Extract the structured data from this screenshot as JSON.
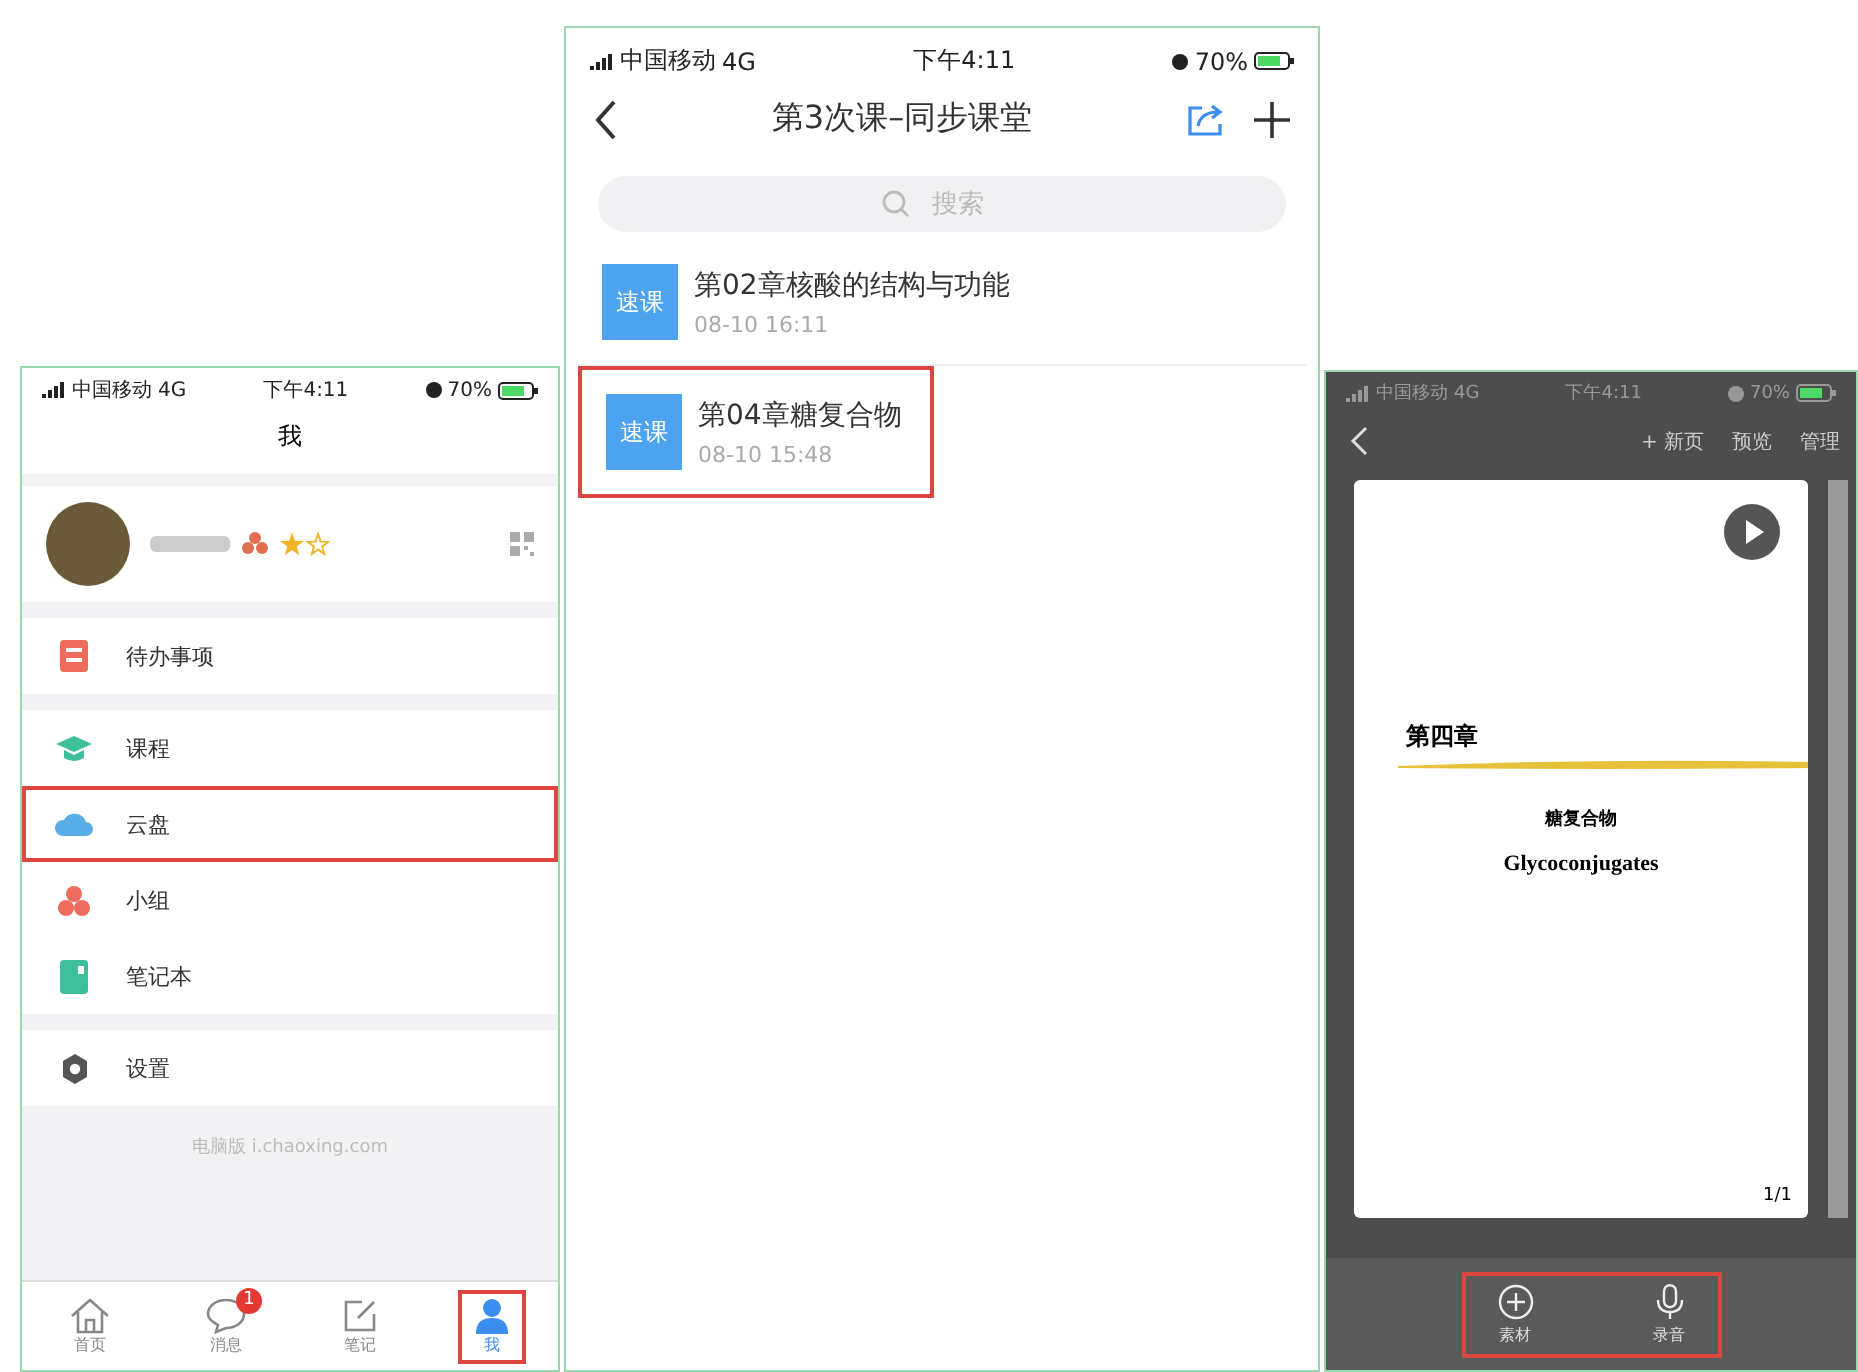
{
  "profile_screen": {
    "status_bar": {
      "carrier": "中国移动",
      "network": "4G",
      "time": "下午4:11",
      "battery": "70%"
    },
    "title": "我",
    "menu_groups": [
      [
        {
          "label": "待办事项",
          "kind": "todo",
          "highlighted": false
        }
      ],
      [
        {
          "label": "课程",
          "kind": "course",
          "highlighted": false
        },
        {
          "label": "云盘",
          "kind": "cloud",
          "highlighted": true
        },
        {
          "label": "小组",
          "kind": "group",
          "highlighted": false
        },
        {
          "label": "笔记本",
          "kind": "notebook",
          "highlighted": false
        }
      ],
      [
        {
          "label": "设置",
          "kind": "settings",
          "highlighted": false
        }
      ]
    ],
    "footer": "电脑版 i.chaoxing.com",
    "tabs": [
      {
        "label": "首页",
        "kind": "home",
        "selected": false,
        "highlighted": false
      },
      {
        "label": "消息",
        "kind": "chat",
        "selected": false,
        "highlighted": false,
        "badge": "1"
      },
      {
        "label": "笔记",
        "kind": "note",
        "selected": false,
        "highlighted": false
      },
      {
        "label": "我",
        "kind": "person",
        "selected": true,
        "highlighted": true
      }
    ]
  },
  "lesson_list_screen": {
    "status_bar": {
      "carrier": "中国移动",
      "network": "4G",
      "time": "下午4:11",
      "battery": "70%"
    },
    "title": "第3次课–同步课堂",
    "search": {
      "placeholder": "搜索"
    },
    "lessons": [
      {
        "thumb": "速课",
        "title": "第02章核酸的结构与功能",
        "date": "08-10 16:11",
        "highlighted": false
      },
      {
        "thumb": "速课",
        "title": "第04章糖复合物",
        "date": "08-10 15:48",
        "highlighted": true
      }
    ]
  },
  "slide_editor_screen": {
    "status_bar": {
      "carrier": "中国移动",
      "network": "4G",
      "time": "下午4:11",
      "battery": "70%"
    },
    "actions": [
      "+ 新页",
      "预览",
      "管理"
    ],
    "slide": {
      "chapter": "第四章",
      "title": "糖复合物",
      "subtitle": "Glycoconjugates",
      "page": "1/1"
    },
    "toolbar": {
      "highlighted": true,
      "buttons": [
        {
          "label": "素材",
          "kind": "add"
        },
        {
          "label": "录音",
          "kind": "mic"
        }
      ]
    }
  }
}
